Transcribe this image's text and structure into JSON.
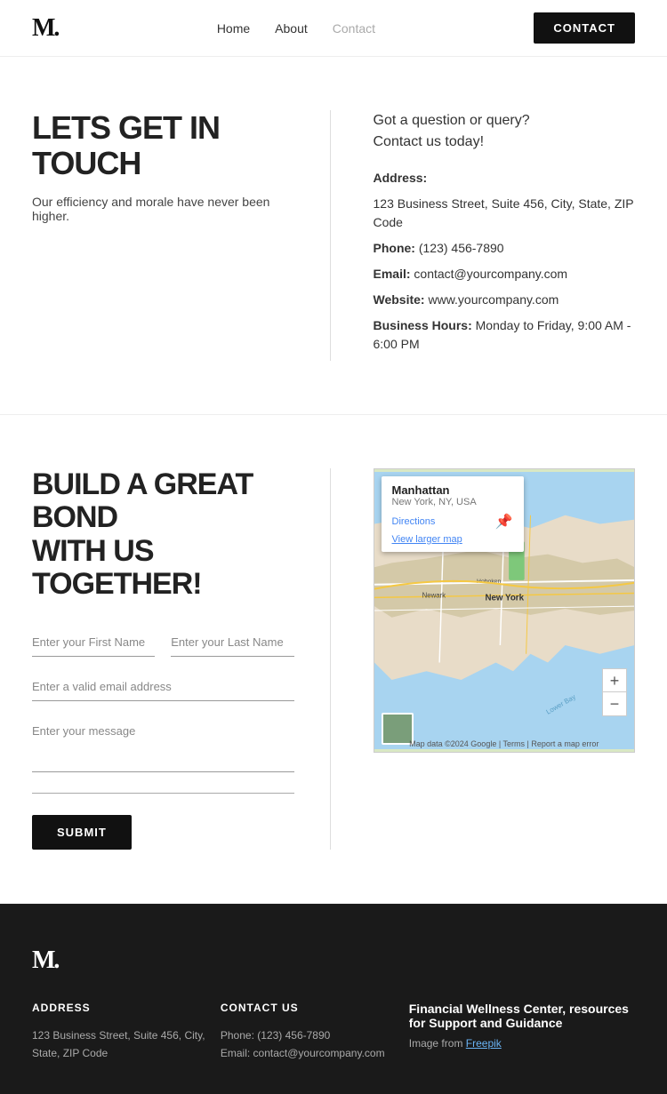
{
  "nav": {
    "logo": "M.",
    "links": [
      {
        "label": "Home",
        "active": false
      },
      {
        "label": "About",
        "active": false
      },
      {
        "label": "Contact",
        "active": true
      }
    ],
    "contact_btn": "CONTACT"
  },
  "hero": {
    "title": "LETS GET IN TOUCH",
    "subtitle": "Our efficiency and morale have never been higher."
  },
  "contact_info": {
    "heading_line1": "Got a question or query?",
    "heading_line2": "Contact us today!",
    "address_label": "Address:",
    "address_value": "123 Business Street, Suite 456, City, State, ZIP Code",
    "phone_label": "Phone:",
    "phone_value": "(123) 456-7890",
    "email_label": "Email:",
    "email_value": "contact@yourcompany.com",
    "website_label": "Website:",
    "website_value": "www.yourcompany.com",
    "hours_label": "Business Hours:",
    "hours_value": "Monday to Friday, 9:00 AM - 6:00 PM"
  },
  "form_section": {
    "title_line1": "BUILD A GREAT BOND",
    "title_line2": "WITH US TOGETHER!",
    "first_name_placeholder": "Enter your First Name",
    "last_name_placeholder": "Enter your Last Name",
    "email_placeholder": "Enter a valid email address",
    "message_placeholder": "Enter your message",
    "submit_label": "SUBMIT"
  },
  "map": {
    "place": "Manhattan",
    "sub": "New York, NY, USA",
    "directions": "Directions",
    "view_larger": "View larger map",
    "credit": "Map data ©2024 Google | Terms | Report a map error"
  },
  "footer": {
    "logo": "M.",
    "address_heading": "ADDRESS",
    "address_value": "123 Business Street, Suite 456, City, State, ZIP Code",
    "contact_heading": "CONTACT US",
    "phone": "Phone: (123) 456-7890",
    "email": "Email: contact@yourcompany.com",
    "wellness_title": "Financial Wellness Center, resources for Support and Guidance",
    "image_from": "Image from",
    "freepik": "Freepik"
  }
}
